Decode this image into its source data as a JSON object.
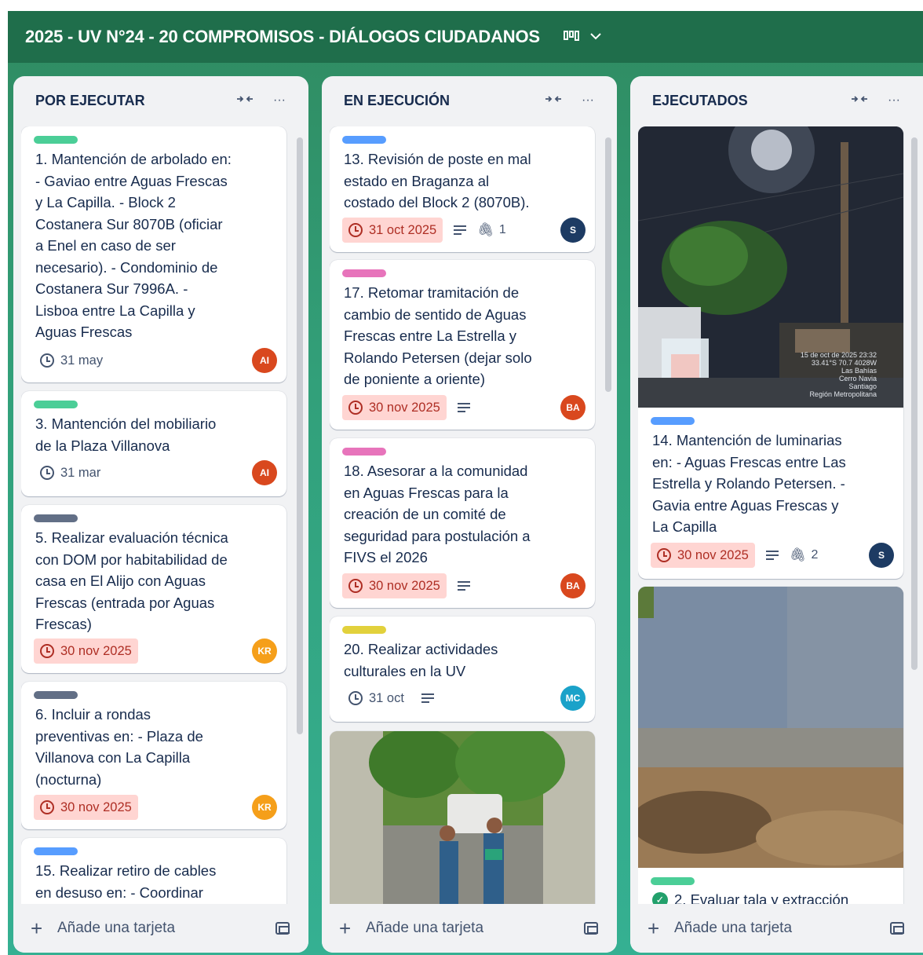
{
  "board": {
    "title": "2025 - UV N°24 - 20 COMPROMISOS - DIÁLOGOS CIUDADANOS",
    "view_icon": "board-view-icon",
    "chevron_icon": "chevron-down-icon"
  },
  "colors": {
    "header": "#1f6e4b",
    "label_green": "#4bce97",
    "label_blue": "#579dff",
    "label_gray": "#626f86",
    "label_pink": "#e774bb",
    "label_yellow": "#e2d13c",
    "overdue_bg": "#ffd5d2",
    "overdue_text": "#ae2e24",
    "avatar_ai": "#d9481e",
    "avatar_kr": "#f59f1a",
    "avatar_s": "#1d3b63",
    "avatar_ba": "#d9481e",
    "avatar_mc": "#1aa2c9"
  },
  "lists": [
    {
      "title": "POR EJECUTAR",
      "collapse_icon": "collapse-icon",
      "menu_icon": "more-icon",
      "add_label": "Añade una tarjeta",
      "cards": [
        {
          "label_color": "green",
          "text": "1. Mantención de arbolado en:\n- Gaviao entre Aguas Frescas\ny La Capilla. - Block 2\nCostanera Sur 8070B (oficiar\na Enel en caso de ser\nnecesario). - Condominio de\nCostanera Sur 7996A. -\nLisboa entre La Capilla y\nAguas Frescas",
          "due": "31 may",
          "overdue": false,
          "avatar": "AI"
        },
        {
          "label_color": "green",
          "text": "3. Mantención del mobiliario\nde la Plaza Villanova",
          "due": "31 mar",
          "overdue": false,
          "avatar": "AI"
        },
        {
          "label_color": "gray",
          "text": "5. Realizar evaluación técnica\ncon DOM por habitabilidad de\ncasa en El Alijo con Aguas\nFrescas (entrada por Aguas\nFrescas)",
          "due": "30 nov 2025",
          "overdue": true,
          "avatar": "KR"
        },
        {
          "label_color": "gray",
          "text": "6. Incluir a rondas\npreventivas en: - Plaza de\nVillanova con La Capilla\n(nocturna)",
          "due": "30 nov 2025",
          "overdue": true,
          "avatar": "KR"
        },
        {
          "label_color": "blue",
          "text": "15. Realizar retiro de cables\nen desuso en: - Coordinar"
        }
      ]
    },
    {
      "title": "EN EJECUCIÓN",
      "collapse_icon": "collapse-icon",
      "menu_icon": "more-icon",
      "add_label": "Añade una tarjeta",
      "cards": [
        {
          "label_color": "blue",
          "text": "13. Revisión de poste en mal\nestado en Braganza al\ncostado del Block 2 (8070B).",
          "due": "31 oct 2025",
          "overdue": true,
          "attachments": "1",
          "avatar": "S"
        },
        {
          "label_color": "pink",
          "text": "17. Retomar tramitación de\ncambio de sentido de Aguas\nFrescas entre La Estrella y\nRolando Petersen (dejar solo\nde poniente a oriente)",
          "due": "30 nov 2025",
          "overdue": true,
          "avatar": "BA"
        },
        {
          "label_color": "pink",
          "text": "18. Asesorar a la comunidad\nen Aguas Frescas para la\ncreación de un comité de\nseguridad para postulación a\nFIVS el 2026",
          "due": "30 nov 2025",
          "overdue": true,
          "avatar": "BA"
        },
        {
          "label_color": "yellow",
          "text": "20. Realizar actividades\nculturales en la UV",
          "due": "31 oct",
          "overdue": false,
          "avatar": "MC"
        }
      ]
    },
    {
      "title": "EJECUTADOS",
      "collapse_icon": "collapse-icon",
      "menu_icon": "more-icon",
      "add_label": "Añade una tarjeta",
      "cards": [
        {
          "label_color": "blue",
          "photo_caption": "15 de oct de 2025 23:32\n33.41°S 70.7 4028W\nLas Bahías\nCerro Navia\nSantiago\nRegión Metropolitana",
          "text": "14. Mantención de luminarias\nen: - Aguas Frescas entre Las\nEstrella y Rolando Petersen. -\nGavia entre Aguas Frescas y\nLa Capilla",
          "due": "30 nov 2025",
          "overdue": true,
          "attachments": "2",
          "avatar": "S"
        },
        {
          "label_color": "green",
          "text": "2. Evaluar tala y extracción"
        }
      ]
    }
  ]
}
